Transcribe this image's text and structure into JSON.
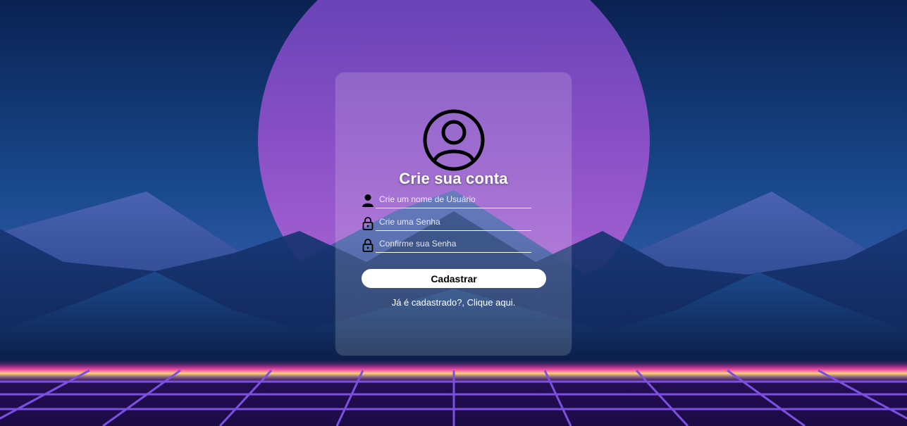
{
  "form": {
    "title": "Crie sua conta",
    "username_placeholder": "Crie um nome de Usuário",
    "password_placeholder": "Crie uma Senha",
    "confirm_placeholder": "Confirme sua Senha",
    "submit_label": "Cadastrar",
    "login_link": "Já é cadastrado?, Clique aqui."
  },
  "icons": {
    "avatar": "user-circle-icon",
    "username": "user-icon",
    "password": "lock-icon",
    "confirm": "lock-icon"
  },
  "colors": {
    "sun": "#9a5ccc",
    "sky_top": "#0b2253",
    "mountain": "#12306a",
    "horizon_glow": "#ff4fa8",
    "grid": "#7b4fe0",
    "button": "#ffffff"
  }
}
